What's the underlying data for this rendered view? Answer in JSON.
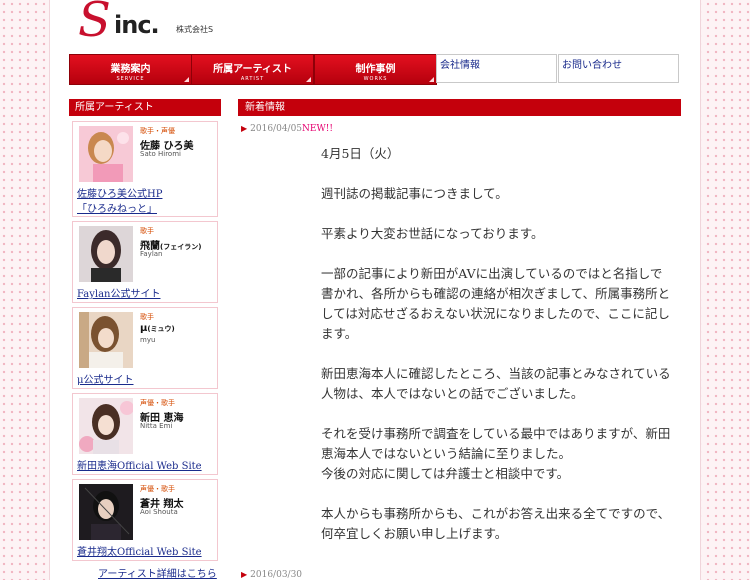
{
  "logo": {
    "text": "inc.",
    "sub": "株式会社S"
  },
  "nav": {
    "buttons": [
      {
        "label": "業務案内",
        "sub": "SERVICE"
      },
      {
        "label": "所属アーティスト",
        "sub": "ARTIST"
      },
      {
        "label": "制作事例",
        "sub": "WORKS"
      }
    ],
    "links": [
      "会社情報",
      "お問い合わせ"
    ]
  },
  "sidebar": {
    "title": "所属アーティスト",
    "artists": [
      {
        "role": "歌手・声優",
        "name": "佐藤 ひろ美",
        "roman": "Sato Hiromi",
        "link": "佐藤ひろ美公式HP",
        "link2": "「ひろみねっと」"
      },
      {
        "role": "歌手",
        "name": "飛蘭",
        "name_ruby": "(フェイラン)",
        "roman": "Faylan",
        "link": "Faylan公式サイト"
      },
      {
        "role": "歌手",
        "name": "μ",
        "name_ruby": "(ミュウ)",
        "roman": "myu",
        "link": "μ公式サイト"
      },
      {
        "role": "声優・歌手",
        "name": "新田 恵海",
        "roman": "Nitta Emi",
        "link": "新田恵海Official Web Site"
      },
      {
        "role": "声優・歌手",
        "name": "蒼井 翔太",
        "roman": "Aoi Shouta",
        "link": "蒼井翔太Official Web Site"
      }
    ],
    "more": "アーティスト詳細はこちら"
  },
  "main": {
    "title": "新着情報",
    "entry": {
      "date": "2016/04/05",
      "new_badge": "NEW!!",
      "paragraphs": [
        "4月5日（火）",
        "週刊誌の掲載記事につきまして。",
        "平素より大変お世話になっております。",
        "一部の記事により新田がAVに出演しているのではと名指しで書かれ、各所からも確認の連絡が相次ぎまして、所属事務所としては対応せざるおえない状況になりましたので、ここに記します。",
        "新田恵海本人に確認したところ、当該の記事とみなされている人物は、本人ではないとの話でございました。",
        "それを受け事務所で調査をしている最中ではありますが、新田恵海本人ではないという結論に至りました。",
        "今後の対応に関しては弁護士と相談中です。",
        "本人からも事務所からも、これがお答え出来る全てですので、何卒宜しくお願い申し上げます。"
      ]
    },
    "next_entry_date": "2016/03/30"
  },
  "colors": {
    "accent": "#c4000c",
    "link": "#1a2b8c",
    "new": "#e5006f",
    "background_dots": "#f1b7c3"
  }
}
